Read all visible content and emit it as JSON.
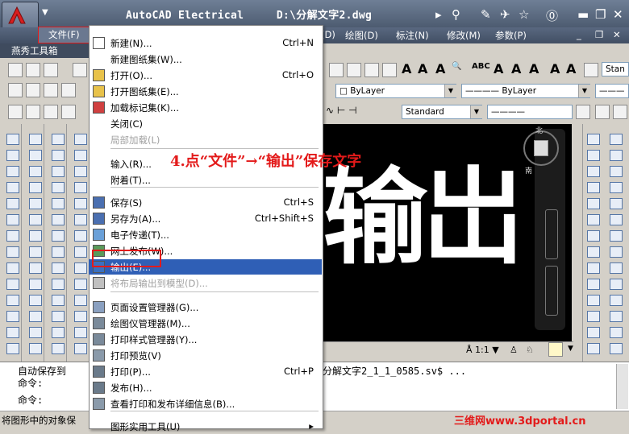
{
  "title_bar": {
    "app_name": "AutoCAD Electrical",
    "file_path": "D:\\分解文字2.dwg"
  },
  "menubar": {
    "file_menu": "文件(F)",
    "items": [
      "(D)",
      "绘图(D)",
      "标注(N)",
      "修改(M)",
      "参数(P)"
    ]
  },
  "toolbar": {
    "custom_label": "燕秀工具箱",
    "layer_combo": "ByLayer",
    "linetype_combo": "ByLayer",
    "dim_style_combo": "Standard",
    "text_style_partial": "Stan"
  },
  "file_menu": {
    "items": [
      {
        "label": "新建(N)...",
        "shortcut": "Ctrl+N",
        "icon": "new-file-icon",
        "disabled": false
      },
      {
        "label": "新建图纸集(W)...",
        "shortcut": "",
        "icon": "",
        "disabled": false
      },
      {
        "label": "打开(O)...",
        "shortcut": "Ctrl+O",
        "icon": "open-folder-icon",
        "disabled": false
      },
      {
        "label": "打开图纸集(E)...",
        "shortcut": "",
        "icon": "open-sheet-set-icon",
        "disabled": false
      },
      {
        "label": "加载标记集(K)...",
        "shortcut": "",
        "icon": "markup-icon",
        "disabled": false
      },
      {
        "label": "关闭(C)",
        "shortcut": "",
        "icon": "",
        "disabled": false
      },
      {
        "label": "局部加载(L)",
        "shortcut": "",
        "icon": "",
        "disabled": true
      },
      {
        "label": "输入(R)...",
        "shortcut": "",
        "icon": "",
        "disabled": false
      },
      {
        "label": "附着(T)...",
        "shortcut": "",
        "icon": "",
        "disabled": false
      },
      {
        "label": "保存(S)",
        "shortcut": "Ctrl+S",
        "icon": "save-disk-icon",
        "disabled": false
      },
      {
        "label": "另存为(A)...",
        "shortcut": "Ctrl+Shift+S",
        "icon": "save-as-icon",
        "disabled": false
      },
      {
        "label": "电子传递(T)...",
        "shortcut": "",
        "icon": "etransmit-icon",
        "disabled": false
      },
      {
        "label": "网上发布(W)...",
        "shortcut": "",
        "icon": "publish-web-icon",
        "disabled": false
      },
      {
        "label": "输出(E)...",
        "shortcut": "",
        "icon": "export-icon",
        "disabled": false
      },
      {
        "label": "将布局输出到模型(D)...",
        "shortcut": "",
        "icon": "layout-export-icon",
        "disabled": true
      },
      {
        "label": "页面设置管理器(G)...",
        "shortcut": "",
        "icon": "page-setup-icon",
        "disabled": false
      },
      {
        "label": "绘图仪管理器(M)...",
        "shortcut": "",
        "icon": "plotter-icon",
        "disabled": false
      },
      {
        "label": "打印样式管理器(Y)...",
        "shortcut": "",
        "icon": "plot-style-icon",
        "disabled": false
      },
      {
        "label": "打印预览(V)",
        "shortcut": "",
        "icon": "print-preview-icon",
        "disabled": false
      },
      {
        "label": "打印(P)...",
        "shortcut": "Ctrl+P",
        "icon": "print-icon",
        "disabled": false
      },
      {
        "label": "发布(H)...",
        "shortcut": "",
        "icon": "publish-icon",
        "disabled": false
      },
      {
        "label": "查看打印和发布详细信息(B)...",
        "shortcut": "",
        "icon": "plot-details-icon",
        "disabled": false
      },
      {
        "label": "图形实用工具(U)",
        "shortcut": "▸",
        "icon": "",
        "disabled": false
      }
    ]
  },
  "annotation": "4.点“文件”→“输出”保存文字",
  "drawing": {
    "text": "输岀"
  },
  "viewport_status": {
    "scale": "1:1"
  },
  "command": {
    "line1": "自动保存到",
    "line1_tail": "分解文字2_1_1_0585.sv$ ...",
    "line2": "命令:",
    "line3": "命令:"
  },
  "status_bar": {
    "text": "将图形中的对象保"
  },
  "watermark": "三维网www.3dportal.cn",
  "colors": {
    "highlight": "#2f5fb6",
    "annotation_red": "#e31a1a",
    "title_bar": "#5b6a82"
  }
}
